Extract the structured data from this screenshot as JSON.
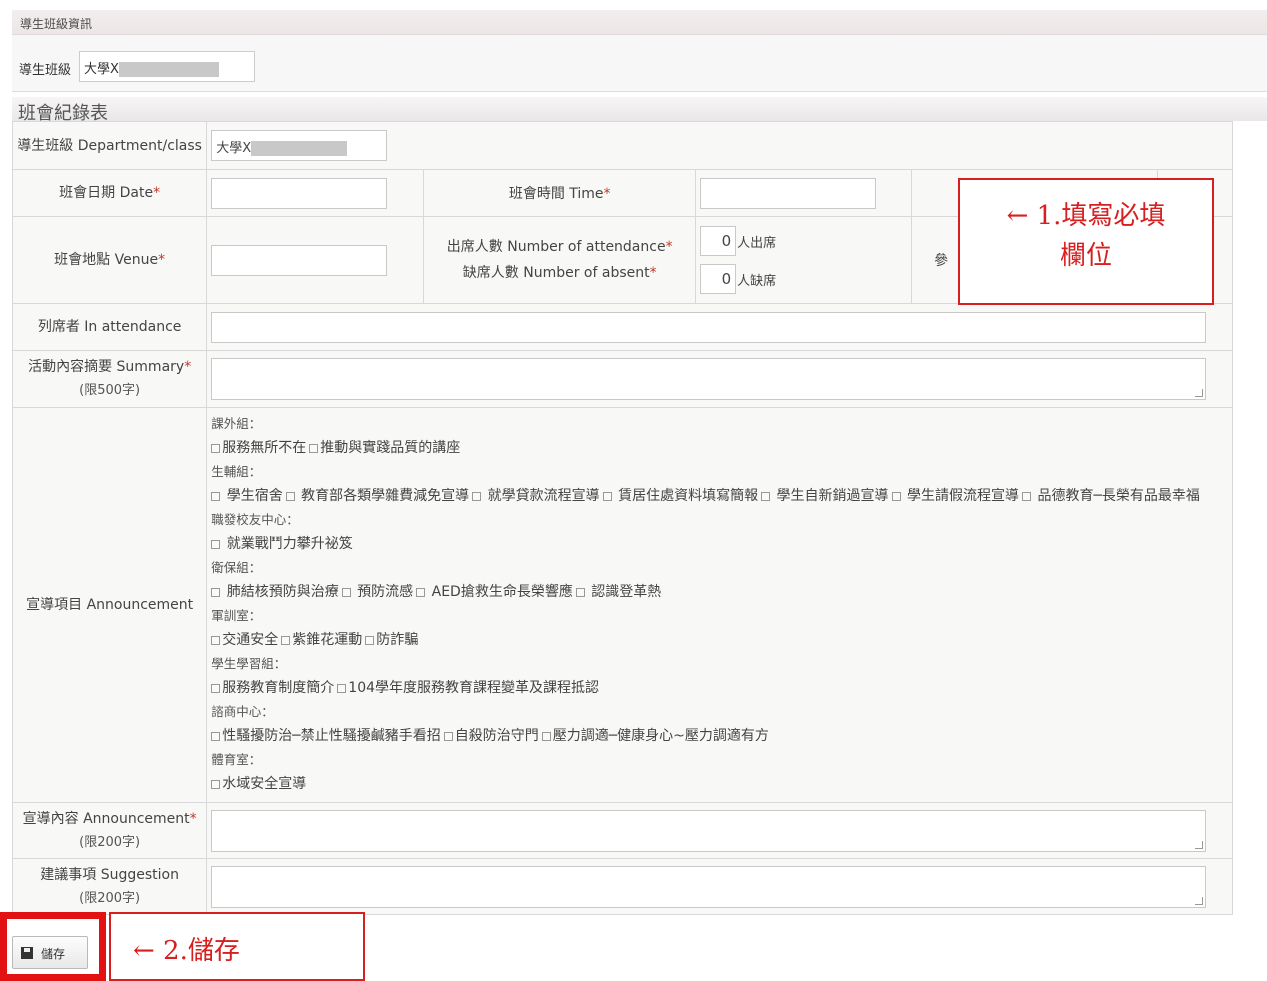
{
  "section": {
    "title": "導生班級資訊",
    "class_label": "導生班級",
    "class_value": "大學X"
  },
  "form": {
    "title": "班會紀錄表",
    "dept_label": "導生班級 Department/class",
    "dept_value": "大學X",
    "date_label": "班會日期 Date",
    "time_label": "班會時間 Time",
    "venue_label": "班會地點 Venue",
    "attendance_label": "出席人數 Number of attendance",
    "absent_label": "缺席人數 Number of absent",
    "attendance_value": "0",
    "attendance_unit": "人出席",
    "absent_value": "0",
    "absent_unit": "人缺席",
    "participant_label_partial": "參",
    "in_attendance_label": "列席者 In attendance",
    "summary_label": "活動內容摘要 Summary",
    "summary_limit": "(限500字)",
    "announcement_label": "宣導項目 Announcement",
    "announce_content_label": "宣導內容 Announcement",
    "announce_limit": "(限200字)",
    "suggestion_label": "建議事項 Suggestion",
    "suggestion_limit": "(限200字)",
    "required_mark": "*",
    "groups": [
      {
        "name": "課外組：",
        "options": [
          "服務無所不在",
          "推動與實踐品質的講座"
        ]
      },
      {
        "name": "生輔組：",
        "options": [
          " 學生宿舍",
          " 教育部各類學雜費減免宣導",
          " 就學貸款流程宣導",
          " 賃居住處資料填寫簡報",
          " 學生自新銷過宣導",
          " 學生請假流程宣導",
          " 品德教育─長榮有品最幸福"
        ]
      },
      {
        "name": "職發校友中心：",
        "options": [
          " 就業戰鬥力攀升祕笈"
        ]
      },
      {
        "name": "衛保組：",
        "options": [
          " 肺結核預防與治療",
          " 預防流感",
          " AED搶救生命長榮響應",
          " 認識登革熱"
        ]
      },
      {
        "name": "軍訓室：",
        "options": [
          "交通安全",
          "紫錐花運動",
          "防詐騙"
        ]
      },
      {
        "name": "學生學習組：",
        "options": [
          "服務教育制度簡介",
          "104學年度服務教育課程變革及課程抵認"
        ]
      },
      {
        "name": "諮商中心：",
        "options": [
          "性騷擾防治─禁止性騷擾鹹豬手看招",
          "自殺防治守門",
          "壓力調適─健康身心~壓力調適有方"
        ]
      },
      {
        "name": "體育室：",
        "options": [
          "水域安全宣導"
        ]
      }
    ]
  },
  "annotations": {
    "step1": "← 1.填寫必填欄位",
    "step1_line1": "← 1.填寫必填",
    "step1_line2": "欄位",
    "step2": "← 2.儲存"
  },
  "buttons": {
    "save_label": "儲存",
    "save_icon": "floppy-disk-icon"
  }
}
